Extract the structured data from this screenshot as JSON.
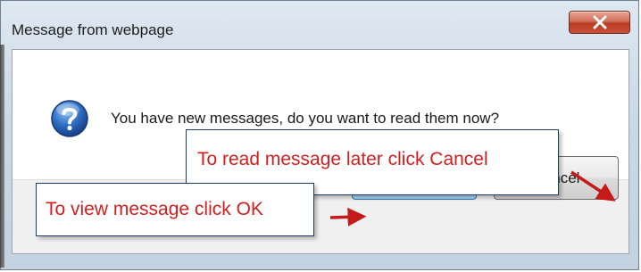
{
  "dialog": {
    "title": "Message from webpage",
    "close_icon": "close-x-icon",
    "message_icon": "question-icon",
    "message": "You have new messages, do you want to read them now?",
    "ok_label": "OK",
    "cancel_label": "Cancel"
  },
  "annotations": {
    "read_later": "To read message later click Cancel",
    "view_now": "To view message click OK",
    "arrow_icon": "red-arrow-icon"
  },
  "colors": {
    "annotation_text": "#d11f1f",
    "arrow": "#c41a1a",
    "callout_border": "#203a63",
    "close_button": "#c9503a"
  }
}
